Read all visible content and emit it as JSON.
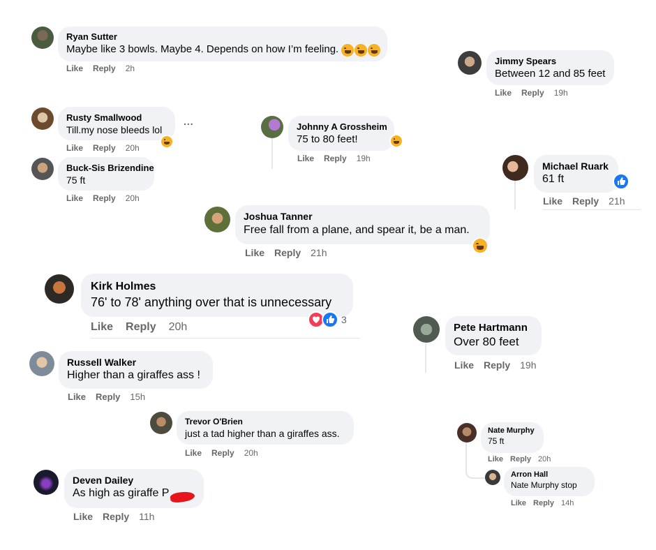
{
  "labels": {
    "like": "Like",
    "reply": "Reply"
  },
  "comments": [
    {
      "name": "Ryan Sutter",
      "text": "Maybe like 3 bowls. Maybe 4. Depends on how I’m feeling.",
      "time": "2h"
    },
    {
      "name": "Jimmy Spears",
      "text": "Between 12 and 85 feet",
      "time": "19h"
    },
    {
      "name": "Rusty Smallwood",
      "text": "Till.my nose bleeds lol",
      "time": "20h",
      "more": "..."
    },
    {
      "name": "Johnny A Grossheim",
      "text": "75 to 80 feet!",
      "time": "19h"
    },
    {
      "name": "Buck-Sis Brizendine",
      "text": "75 ft",
      "time": "20h"
    },
    {
      "name": "Michael Ruark",
      "text": "61 ft",
      "time": "21h"
    },
    {
      "name": "Joshua Tanner",
      "text": "Free fall from a plane, and spear it, be a man.",
      "time": "21h"
    },
    {
      "name": "Kirk Holmes",
      "text": "76' to 78' anything over that is unnecessary",
      "time": "20h",
      "reaction_count": "3"
    },
    {
      "name": "Pete Hartmann",
      "text": "Over 80 feet",
      "time": "19h"
    },
    {
      "name": "Russell Walker",
      "text": "Higher than a giraffes ass !",
      "time": "15h"
    },
    {
      "name": "Trevor O'Brien",
      "text": "just a tad higher than a giraffes ass.",
      "time": "20h"
    },
    {
      "name": "Nate Murphy",
      "text": "75 ft",
      "time": "20h"
    },
    {
      "name": "Arron Hall",
      "text": "Nate Murphy stop",
      "time": "14h"
    },
    {
      "name": "Deven Dailey",
      "text": "As high as giraffe P",
      "time": "11h"
    }
  ],
  "colors": {
    "bubble": "#f0f2f5",
    "action_text": "#65676b",
    "like_blue": "#1877f2",
    "haha_yellow": "#f7b125",
    "love_red": "#f33e58",
    "redaction": "#e8141b"
  },
  "icons": [
    "laughing-emoji-icon",
    "like-thumb-icon",
    "love-heart-icon"
  ]
}
